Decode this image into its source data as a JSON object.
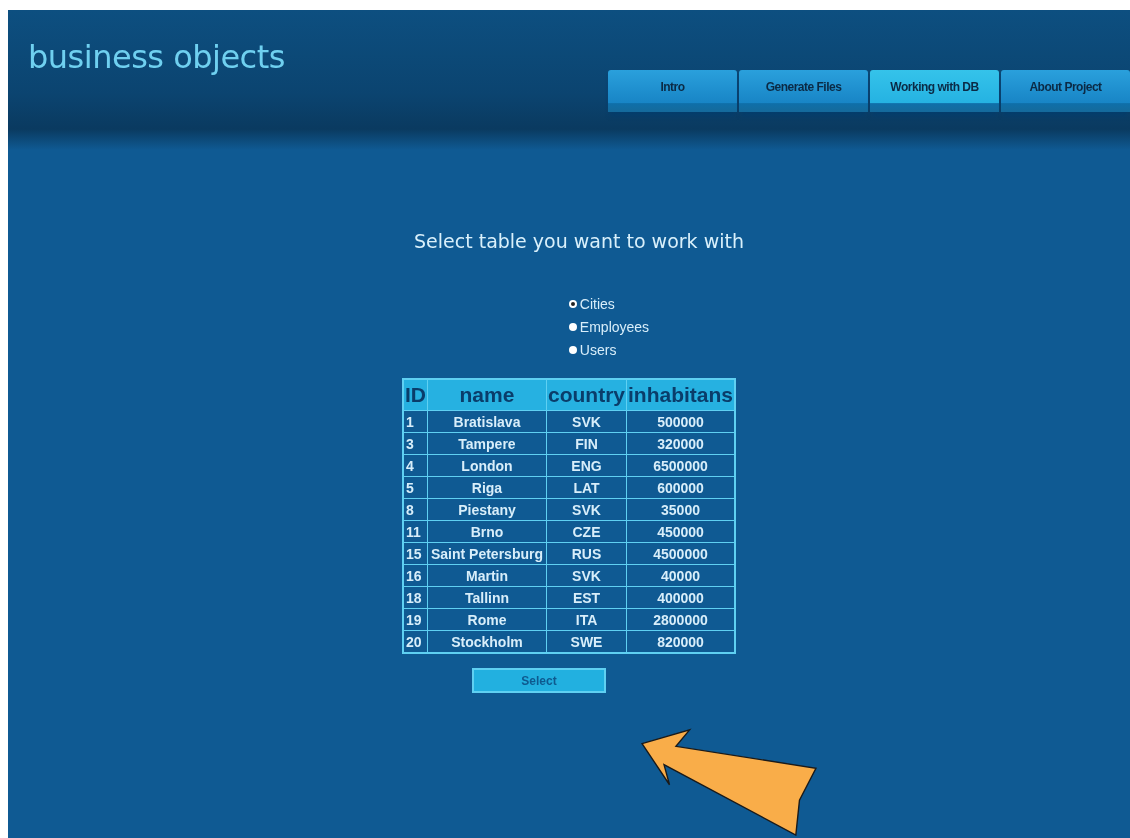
{
  "logo": "business objects",
  "tabs": [
    {
      "label": "Intro",
      "selected": false
    },
    {
      "label": "Generate Files",
      "selected": false
    },
    {
      "label": "Working with DB",
      "selected": true
    },
    {
      "label": "About Project",
      "selected": false
    }
  ],
  "heading": "Select table you want to work with",
  "options": [
    {
      "label": "Cities",
      "selected": true
    },
    {
      "label": "Employees",
      "selected": false
    },
    {
      "label": "Users",
      "selected": false
    }
  ],
  "table": {
    "columns": [
      "ID",
      "name",
      "country",
      "inhabitans"
    ],
    "rows": [
      [
        "1",
        "Bratislava",
        "SVK",
        "500000"
      ],
      [
        "3",
        "Tampere",
        "FIN",
        "320000"
      ],
      [
        "4",
        "London",
        "ENG",
        "6500000"
      ],
      [
        "5",
        "Riga",
        "LAT",
        "600000"
      ],
      [
        "8",
        "Piestany",
        "SVK",
        "35000"
      ],
      [
        "11",
        "Brno",
        "CZE",
        "450000"
      ],
      [
        "15",
        "Saint Petersburg",
        "RUS",
        "4500000"
      ],
      [
        "16",
        "Martin",
        "SVK",
        "40000"
      ],
      [
        "18",
        "Tallinn",
        "EST",
        "400000"
      ],
      [
        "19",
        "Rome",
        "ITA",
        "2800000"
      ],
      [
        "20",
        "Stockholm",
        "SWE",
        "820000"
      ]
    ]
  },
  "button": "Select"
}
